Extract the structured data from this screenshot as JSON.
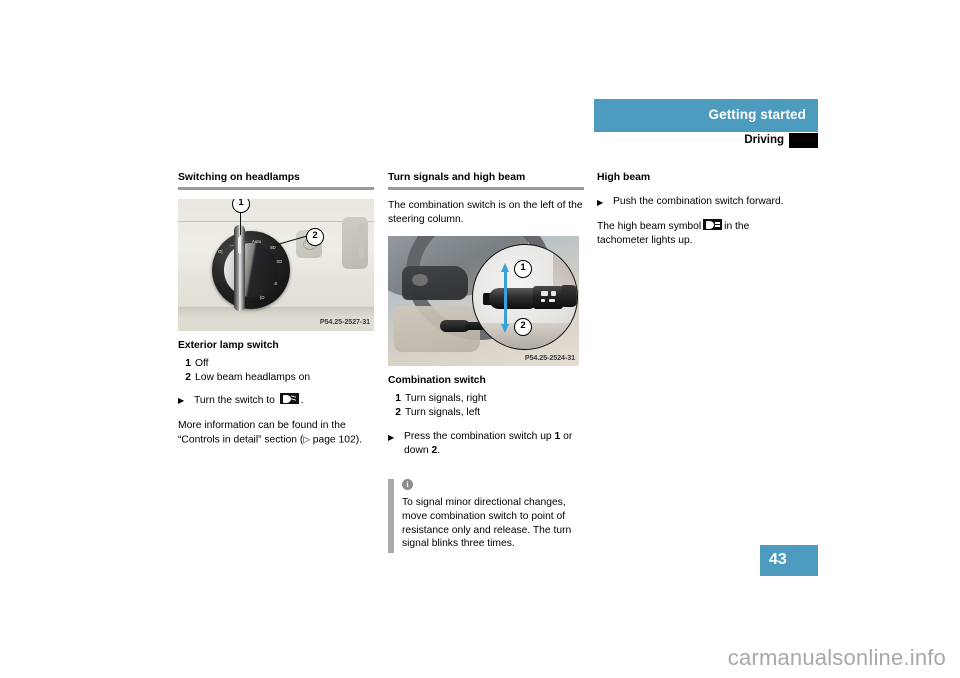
{
  "header": {
    "title": "Getting started",
    "subtitle": "Driving",
    "band_color": "#4e9bc0",
    "tab_color": "#000000"
  },
  "page": {
    "number": "43",
    "number_block_color": "#4e9bc0",
    "watermark": "carmanualsonline.info"
  },
  "columns": {
    "left": {
      "heading": "Switching on headlamps",
      "figure": {
        "name": "headlamp-rotary-switch-photo",
        "caption_id": "P54.25-2527-31",
        "callouts": [
          "1",
          "2"
        ],
        "dial_labels": [
          "Auto",
          "Off"
        ]
      },
      "figure_caption": "Exterior lamp switch",
      "legend": [
        {
          "num": "1",
          "text": "Off"
        },
        {
          "num": "2",
          "text": "Low beam headlamps on"
        }
      ],
      "instruction_prefix": "Turn the switch to",
      "instruction_suffix": ".",
      "instruction_symbol": "low-beam-symbol",
      "more_info_line1": "More information can be found in the",
      "more_info_line2_a": "“Controls in detail” section (",
      "more_info_ref": "page 102",
      "more_info_line2_b": ")."
    },
    "middle": {
      "heading": "Turn signals and high beam",
      "intro": "The combination switch is on the left of the steering column.",
      "figure": {
        "name": "combination-switch-photo",
        "caption_id": "P54.25-2524-31",
        "callouts": [
          "1",
          "2"
        ],
        "arrow_color": "#3aa0d8"
      },
      "figure_caption": "Combination switch",
      "legend": [
        {
          "num": "1",
          "text": "Turn signals, right"
        },
        {
          "num": "2",
          "text": "Turn signals, left"
        }
      ],
      "instruction_a": "Press the combination switch up",
      "instruction_num1": "1",
      "instruction_b": "or down",
      "instruction_num2": "2",
      "instruction_c": ".",
      "note": {
        "icon": "info-icon",
        "icon_glyph": "i",
        "text": "To signal minor directional changes, move combination switch to point of resistance only and release. The turn signal blinks three times.",
        "bar_color": "#a9a9a9"
      }
    },
    "right": {
      "heading": "High beam",
      "instruction": "Push the combination switch forward.",
      "symbol_text_a": "The high beam symbol",
      "symbol_name": "high-beam-symbol",
      "symbol_text_b": "in the tachometer lights up."
    }
  }
}
